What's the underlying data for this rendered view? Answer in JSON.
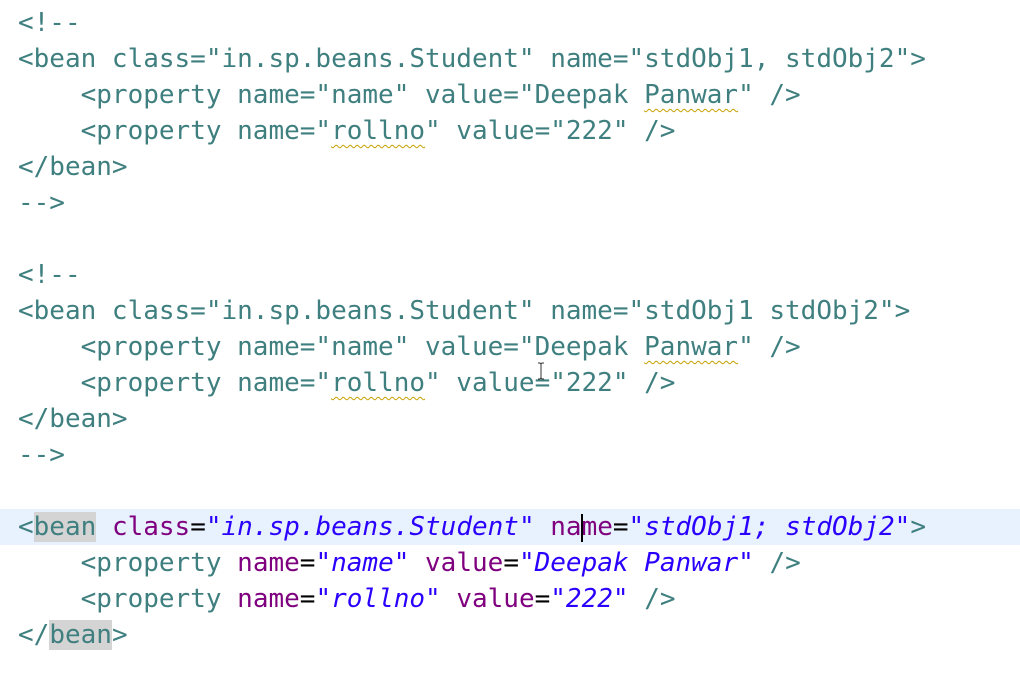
{
  "editor": {
    "block1": {
      "open_comment": "<!--",
      "bean_line": "<bean class=\"in.sp.beans.Student\" name=\"stdObj1, stdObj2\">",
      "prop1_pre": "<property name=\"name\" value=\"Deepak ",
      "prop1_spell": "Panwar",
      "prop1_post": "\" />",
      "prop2_pre": "<property name=\"",
      "prop2_spell": "rollno",
      "prop2_post": "\" value=\"222\" />",
      "close_bean": "</bean>",
      "close_comment": "-->"
    },
    "block2": {
      "open_comment": "<!--",
      "bean_line": "<bean class=\"in.sp.beans.Student\" name=\"stdObj1 stdObj2\">",
      "prop1_pre": "<property name=\"name\" value=\"Deepak ",
      "prop1_spell": "Panwar",
      "prop1_post": "\" />",
      "prop2_pre": "<property name=\"",
      "prop2_spell": "rollno",
      "prop2_post": "\" value=\"222\" />",
      "close_bean": "</bean>",
      "close_comment": "-->"
    },
    "block3": {
      "lt": "<",
      "bean_tag": "bean",
      "class_attr": "class",
      "class_val": "\"in.sp.beans.Student\"",
      "name_attr_a": "na",
      "name_attr_b": "me",
      "name_val": "\"stdObj1; stdObj2\"",
      "gt": ">",
      "prop_tag": "<property",
      "name_attr": "name",
      "value_attr": "value",
      "prop1_name_val": "\"name\"",
      "prop1_value_val": "\"Deepak Panwar\"",
      "prop2_name_val": "\"rollno\"",
      "prop2_value_val": "\"222\"",
      "self_close": "/>",
      "close_lt": "</",
      "close_bean_tag": "bean",
      "close_gt": ">"
    },
    "indent": "    ",
    "equals": "=",
    "space": " "
  },
  "colors": {
    "tag": "#3f7f7f",
    "attribute": "#7f007f",
    "value": "#2a00ff",
    "current_line": "#e8f2fe",
    "tag_highlight": "#d4d4d4"
  }
}
